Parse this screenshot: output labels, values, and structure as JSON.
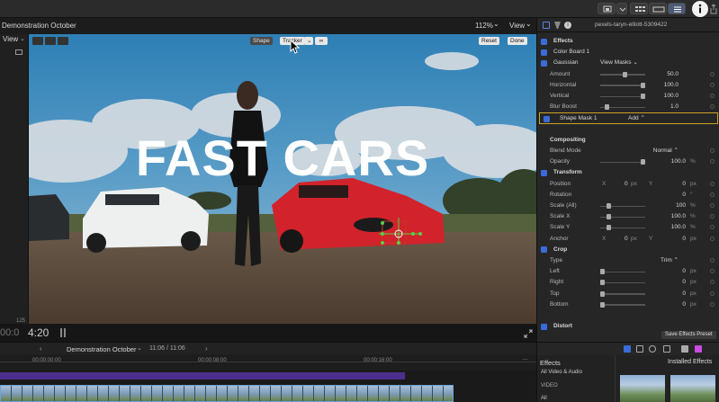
{
  "viewer": {
    "title": "Demonstration October",
    "zoom": "112%",
    "zoom_caret": "⌄",
    "view_label": "View",
    "left_view_label": "View",
    "overlay_title": "FAST CARS",
    "shape_label": "Shape",
    "tracker_label": "Tracker",
    "reset_label": "Reset",
    "done_label": "Done",
    "timecode": "4:20",
    "left_timecode": "00:0",
    "small_counter": "125"
  },
  "inspector": {
    "clip_name": "pexels-taryn-elliott-5309422",
    "rows": [
      {
        "label": "Effects",
        "type": "section",
        "checked": true
      },
      {
        "label": "Color Board 1",
        "type": "effect",
        "checked": true
      },
      {
        "label": "Gaussian",
        "type": "effect",
        "checked": true,
        "extra": "View Masks ⌄"
      },
      {
        "label": "Amount",
        "type": "param",
        "value": "50.0",
        "slider": 0.55
      },
      {
        "label": "Horizontal",
        "type": "param",
        "value": "100.0",
        "slider": 1.0
      },
      {
        "label": "Vertical",
        "type": "param",
        "value": "100.0",
        "slider": 1.0
      },
      {
        "label": "Blur Boost",
        "type": "param",
        "value": "1.0",
        "slider": 0.1
      },
      {
        "label": "Shape Mask 1",
        "type": "mask",
        "checked": true,
        "extra": "Add ⌃"
      },
      {
        "label": "",
        "type": "spacer"
      },
      {
        "label": "Compositing",
        "type": "subsection"
      },
      {
        "label": "Blend Mode",
        "type": "param",
        "value": "Normal ⌃"
      },
      {
        "label": "Opacity",
        "type": "param",
        "value": "100.0",
        "unit": "%",
        "slider": 1.0
      },
      {
        "label": "Transform",
        "type": "section",
        "checked": true
      },
      {
        "label": "Position",
        "type": "xy",
        "x": "0",
        "y": "0",
        "unit": "px"
      },
      {
        "label": "Rotation",
        "type": "param",
        "value": "0",
        "unit": "°"
      },
      {
        "label": "Scale (All)",
        "type": "param",
        "value": "100",
        "unit": "%",
        "slider": 0.15
      },
      {
        "label": "Scale X",
        "type": "param",
        "value": "100.0",
        "unit": "%",
        "slider": 0.15
      },
      {
        "label": "Scale Y",
        "type": "param",
        "value": "100.0",
        "unit": "%",
        "slider": 0.15
      },
      {
        "label": "Anchor",
        "type": "xy",
        "x": "0",
        "y": "0",
        "unit": "px"
      },
      {
        "label": "Crop",
        "type": "section",
        "checked": true
      },
      {
        "label": "Type",
        "type": "param",
        "value": "Trim ⌃"
      },
      {
        "label": "Left",
        "type": "param",
        "value": "0",
        "unit": "px",
        "slider": 0.0
      },
      {
        "label": "Right",
        "type": "param",
        "value": "0",
        "unit": "px",
        "slider": 0.0
      },
      {
        "label": "Top",
        "type": "param",
        "value": "0",
        "unit": "px",
        "slider": 0.0
      },
      {
        "label": "Bottom",
        "type": "param",
        "value": "0",
        "unit": "px",
        "slider": 0.0
      },
      {
        "label": "",
        "type": "spacer"
      },
      {
        "label": "Distort",
        "type": "section",
        "checked": true
      }
    ],
    "x_label": "X",
    "y_label": "Y",
    "save_preset": "Save Effects Preset"
  },
  "timeline": {
    "project": "Demonstration October",
    "duration": "11:06 / 11:06",
    "ruler_marks": [
      "00:00:00:00",
      "00:00:04:00",
      "00:00:08:00",
      "00:00:12:00"
    ],
    "ruler_marks_right": [
      "00:00:16:00",
      "00:00:"
    ]
  },
  "effects_browser": {
    "title": "Effects",
    "installed": "Installed Effects",
    "categories": [
      "All Video & Audio",
      "VIDEO",
      "All"
    ]
  },
  "colors": {
    "accent": "#3b6bd8",
    "mask_outline": "#c9a227",
    "track_purple": "#4b2f8c",
    "clip_outline": "#6fa3d8",
    "tracker_green": "#58d048"
  }
}
